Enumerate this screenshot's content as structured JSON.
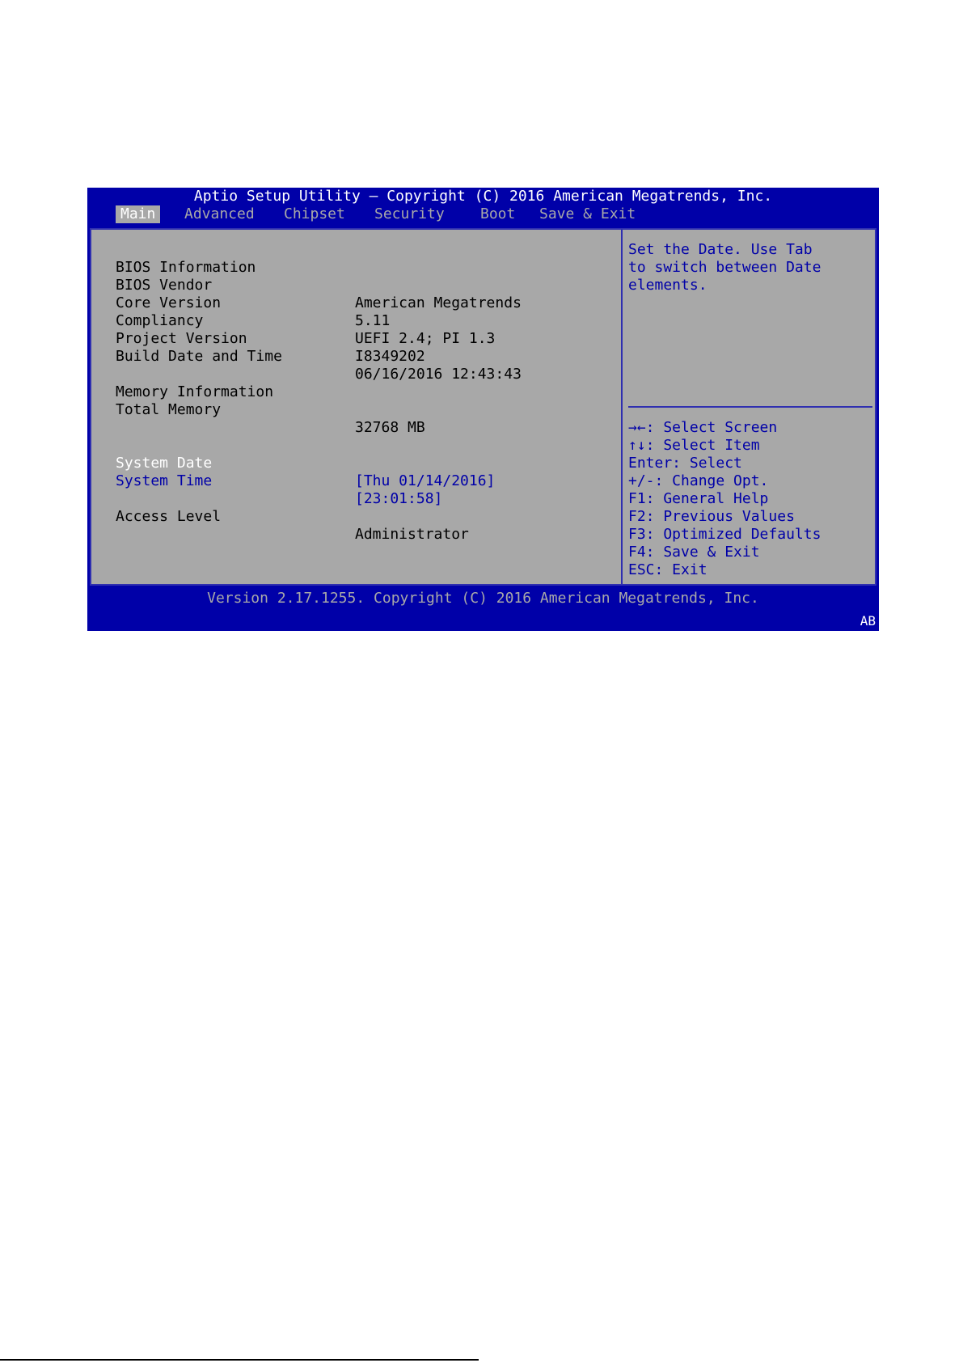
{
  "title": "Aptio Setup Utility – Copyright (C) 2016 American Megatrends, Inc.",
  "tabs": [
    {
      "label": "Main",
      "active": true
    },
    {
      "label": "Advanced",
      "active": false
    },
    {
      "label": "Chipset",
      "active": false
    },
    {
      "label": "Security",
      "active": false
    },
    {
      "label": "Boot",
      "active": false
    },
    {
      "label": "Save & Exit",
      "active": false
    }
  ],
  "main": {
    "bios_info_heading": "BIOS Information",
    "bios_vendor": {
      "label": "BIOS Vendor",
      "value": "American Megatrends"
    },
    "core_version": {
      "label": "Core Version",
      "value": "5.11"
    },
    "compliancy": {
      "label": "Compliancy",
      "value": "UEFI 2.4; PI 1.3"
    },
    "project_version": {
      "label": "Project Version",
      "value": "I8349202"
    },
    "build_date": {
      "label": "Build Date and Time",
      "value": "06/16/2016 12:43:43"
    },
    "memory_info_heading": "Memory Information",
    "total_memory": {
      "label": "Total Memory",
      "value": "32768 MB"
    },
    "system_date": {
      "label": "System Date",
      "value": "[Thu 01/14/2016]"
    },
    "system_time": {
      "label": "System Time",
      "value": "[23:01:58]"
    },
    "access_level": {
      "label": "Access Level",
      "value": "Administrator"
    }
  },
  "help": {
    "description": [
      "Set the Date. Use Tab",
      "to switch between Date",
      "elements."
    ],
    "keys": [
      "→←: Select Screen",
      "↑↓: Select Item",
      "Enter: Select",
      "+/-: Change Opt.",
      "F1: General Help",
      "F2: Previous Values",
      "F3: Optimized Defaults",
      "F4: Save & Exit",
      "ESC: Exit"
    ]
  },
  "footer": "Version 2.17.1255. Copyright (C) 2016 American Megatrends, Inc.",
  "corner_badge": "AB",
  "colors": {
    "frame_blue": "#0000a8",
    "panel_gray": "#a8a8a8",
    "text_black": "#000000",
    "highlight_white": "#ffffff"
  }
}
